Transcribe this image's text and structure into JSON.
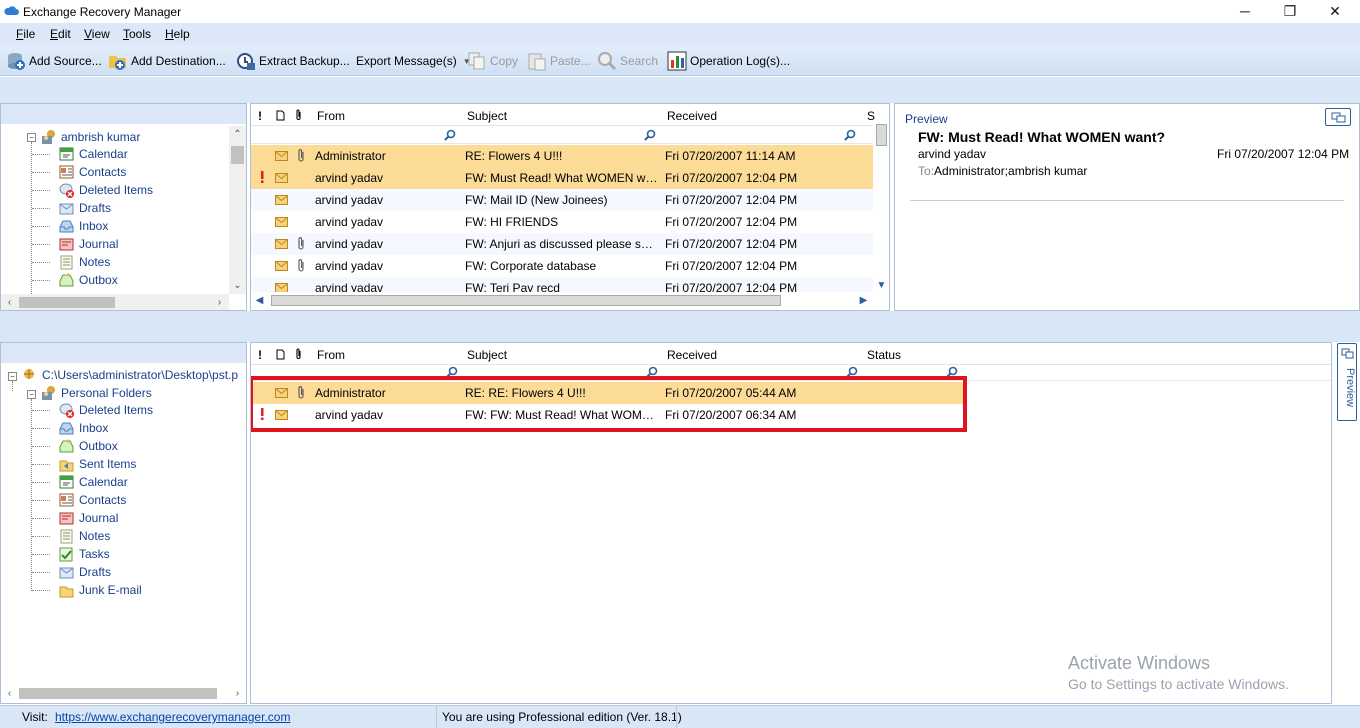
{
  "window": {
    "title": "Exchange Recovery Manager",
    "minimize": "─",
    "maximize": "❐",
    "close": "✕"
  },
  "menu": [
    {
      "label": "File",
      "accel": "F",
      "rest": "ile"
    },
    {
      "label": "Edit",
      "accel": "E",
      "rest": "dit"
    },
    {
      "label": "View",
      "accel": "V",
      "rest": "iew"
    },
    {
      "label": "Tools",
      "accel": "T",
      "rest": "ools"
    },
    {
      "label": "Help",
      "accel": "H",
      "rest": "elp"
    }
  ],
  "toolbar": {
    "add_source": "Add Source...",
    "add_destination": "Add Destination...",
    "extract_backup": "Extract Backup...",
    "export_messages": "Export Message(s)",
    "copy": "Copy",
    "paste": "Paste...",
    "search": "Search",
    "operation_logs": "Operation Log(s)..."
  },
  "source_tree": {
    "root": "ambrish kumar",
    "items": [
      "Calendar",
      "Contacts",
      "Deleted Items",
      "Drafts",
      "Inbox",
      "Journal",
      "Notes",
      "Outbox"
    ]
  },
  "columns": {
    "importance": "!",
    "type": "🗋",
    "attach": "0",
    "from": "From",
    "subject": "Subject",
    "received": "Received",
    "status": "Status",
    "status_short": "S"
  },
  "source_messages": [
    {
      "flag": false,
      "attach": true,
      "from": "Administrator",
      "subject": "RE: Flowers 4 U!!!",
      "received": "Fri 07/20/2007 11:14 AM",
      "highlight": true
    },
    {
      "flag": true,
      "attach": false,
      "from": "arvind yadav",
      "subject": "FW: Must Read! What WOMEN want?",
      "received": "Fri 07/20/2007 12:04 PM",
      "highlight": true
    },
    {
      "flag": false,
      "attach": false,
      "from": "arvind yadav",
      "subject": "FW: Mail ID (New Joinees)",
      "received": "Fri 07/20/2007 12:04 PM",
      "highlight": false
    },
    {
      "flag": false,
      "attach": false,
      "from": "arvind yadav",
      "subject": "FW: HI FRIENDS",
      "received": "Fri 07/20/2007 12:04 PM",
      "highlight": false
    },
    {
      "flag": false,
      "attach": true,
      "from": "arvind yadav",
      "subject": "FW: Anjuri as discussed please send t...",
      "received": "Fri 07/20/2007 12:04 PM",
      "highlight": false
    },
    {
      "flag": false,
      "attach": true,
      "from": "arvind yadav",
      "subject": "FW: Corporate database",
      "received": "Fri 07/20/2007 12:04 PM",
      "highlight": false
    },
    {
      "flag": false,
      "attach": false,
      "from": "arvind yadav",
      "subject": "FW: Teri Pay recd",
      "received": "Fri 07/20/2007 12:04 PM",
      "highlight": false
    }
  ],
  "preview": {
    "label": "Preview",
    "subject": "FW: Must Read! What WOMEN want?",
    "from": "arvind yadav",
    "date": "Fri 07/20/2007 12:04 PM",
    "to_label": "To:",
    "to": "Administrator;ambrish kumar"
  },
  "dest_tree": {
    "root": "C:\\Users\\administrator\\Desktop\\pst.p",
    "folder": "Personal Folders",
    "items": [
      "Deleted Items",
      "Inbox",
      "Outbox",
      "Sent Items",
      "Calendar",
      "Contacts",
      "Journal",
      "Notes",
      "Tasks",
      "Drafts",
      "Junk E-mail"
    ]
  },
  "dest_messages": [
    {
      "flag": false,
      "attach": true,
      "from": "Administrator",
      "subject": "RE:  RE: Flowers 4 U!!!",
      "received": "Fri 07/20/2007 05:44 AM",
      "highlight": true
    },
    {
      "flag": true,
      "attach": false,
      "from": "arvind yadav",
      "subject": "FW:  FW: Must Read! What WOMEN ...",
      "received": "Fri 07/20/2007 06:34 AM",
      "highlight": false
    }
  ],
  "side_tab": "Preview",
  "status": {
    "visit_label": "Visit:",
    "url": "https://www.exchangerecoverymanager.com",
    "edition": "You are using Professional edition (Ver. 18.1)"
  },
  "watermark": {
    "title": "Activate Windows",
    "subtitle": "Go to Settings to activate Windows."
  },
  "colors": {
    "highlight": "#fbdb96",
    "selection_border": "#e0141e",
    "link": "#1a3f8c",
    "band": "#d9e6f6"
  }
}
